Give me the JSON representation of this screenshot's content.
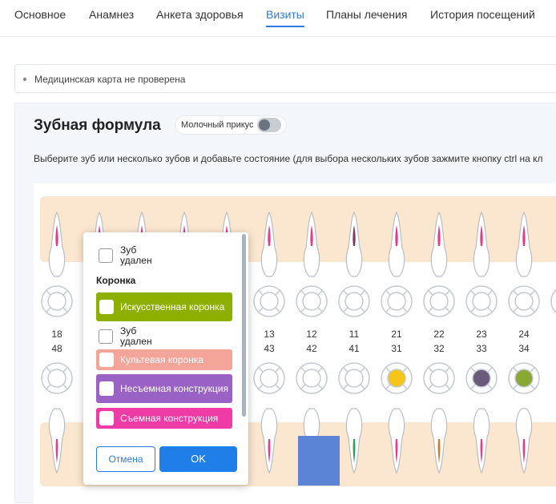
{
  "tabs": [
    {
      "label": "Основное"
    },
    {
      "label": "Анамнез"
    },
    {
      "label": "Анкета здоровья"
    },
    {
      "label": "Визиты"
    },
    {
      "label": "Планы лечения"
    },
    {
      "label": "История посещений"
    }
  ],
  "active_tab": "Визиты",
  "notice": "Медицинская карта не проверена",
  "formula": {
    "title": "Зубная формула",
    "milk_toggle_label": "Молочный прикус",
    "milk_toggle_on": false,
    "hint": "Выберите зуб или несколько зубов и добавьте состояние (для выбора нескольких зубов зажмите кнопку ctrl на кл"
  },
  "upper_numbers": [
    "18",
    "13",
    "12",
    "11",
    "21",
    "22",
    "23",
    "24"
  ],
  "lower_numbers": [
    "48",
    "43",
    "42",
    "41",
    "31",
    "32",
    "33",
    "34"
  ],
  "lower_marks": {
    "31": {
      "color": "#f5c518"
    },
    "33": {
      "color": "#6b5b7b"
    },
    "34": {
      "color": "#8aa832"
    }
  },
  "popup": {
    "top_option": "Зуб удален",
    "section": "Коронка",
    "options": [
      {
        "label": "Искусственная коронка",
        "color": "#8db000"
      },
      {
        "label": "Зуб удален",
        "color": ""
      },
      {
        "label": "Культевая коронка",
        "color": "#f4a59a"
      },
      {
        "label": "Несъемная конструкция",
        "color": "#9b62c6"
      },
      {
        "label": "Съемная конструкция",
        "color": "#ee3ba5"
      }
    ],
    "cancel": "Отмена",
    "ok": "OK"
  },
  "colors": {
    "accent": "#2c7be5",
    "band": "#fbe6cf",
    "selected_tooth": "#5b84d6"
  }
}
